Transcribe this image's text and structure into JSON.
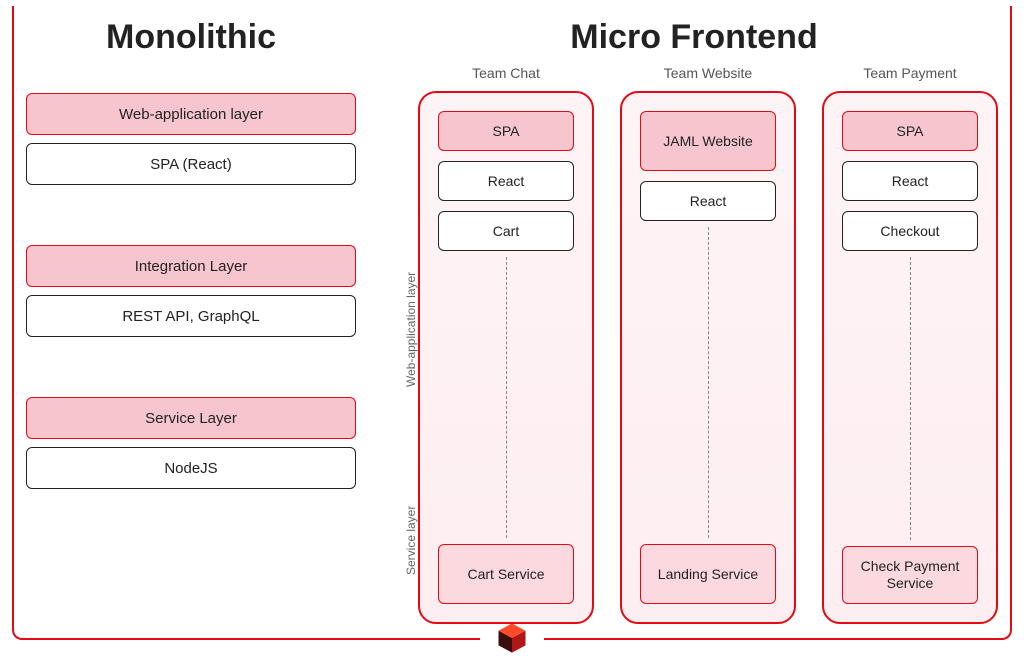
{
  "monolithic": {
    "title": "Monolithic",
    "groups": [
      {
        "pink": "Web-application layer",
        "white": "SPA (React)"
      },
      {
        "pink": "Integration Layer",
        "white": "REST API, GraphQL"
      },
      {
        "pink": "Service Layer",
        "white": "NodeJS"
      }
    ]
  },
  "micro": {
    "title": "Micro Frontend",
    "side_labels": {
      "web": "Web-application layer",
      "service": "Service layer"
    },
    "teams": [
      {
        "name": "Team Chat",
        "top_pink": "SPA",
        "whites": [
          "React",
          "Cart"
        ],
        "service": "Cart Service"
      },
      {
        "name": "Team Website",
        "top_pink": "JAML Website",
        "top_tall": true,
        "whites": [
          "React"
        ],
        "service": "Landing Service"
      },
      {
        "name": "Team Payment",
        "top_pink": "SPA",
        "whites": [
          "React",
          "Checkout"
        ],
        "service": "Check Payment Service"
      }
    ]
  }
}
